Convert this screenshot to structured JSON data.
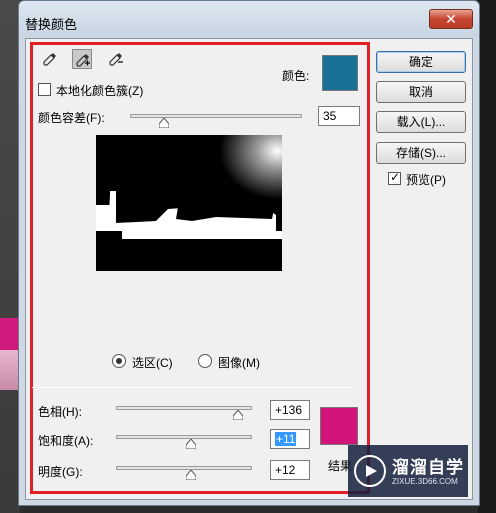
{
  "window": {
    "title": "替换颜色",
    "close_label": "✕"
  },
  "tools": {
    "eyedropper": "eyedropper-icon",
    "eyedropper_add": "eyedropper-plus-icon",
    "eyedropper_sub": "eyedropper-minus-icon"
  },
  "localized_clusters": {
    "label": "本地化颜色簇(Z)",
    "checked": false
  },
  "color": {
    "label": "颜色:",
    "value": "#1a6f94"
  },
  "fuzziness": {
    "label": "颜色容差(F):",
    "value": "35",
    "position": 0.2
  },
  "view": {
    "selection_label": "选区(C)",
    "image_label": "图像(M)",
    "selected": "selection"
  },
  "hue": {
    "label": "色相(H):",
    "value": "+136",
    "position": 0.9
  },
  "saturation": {
    "label": "饱和度(A):",
    "value": "+11",
    "position": 0.55
  },
  "lightness": {
    "label": "明度(G):",
    "value": "+12",
    "position": 0.55
  },
  "result": {
    "label": "结果",
    "value": "#d3147a"
  },
  "buttons": {
    "ok": "确定",
    "cancel": "取消",
    "load": "载入(L)...",
    "save": "存储(S)...",
    "preview_label": "预览(P)",
    "preview_checked": true
  },
  "watermark": {
    "title": "溜溜自学",
    "subtitle": "ZIXUE.3D66.COM"
  }
}
